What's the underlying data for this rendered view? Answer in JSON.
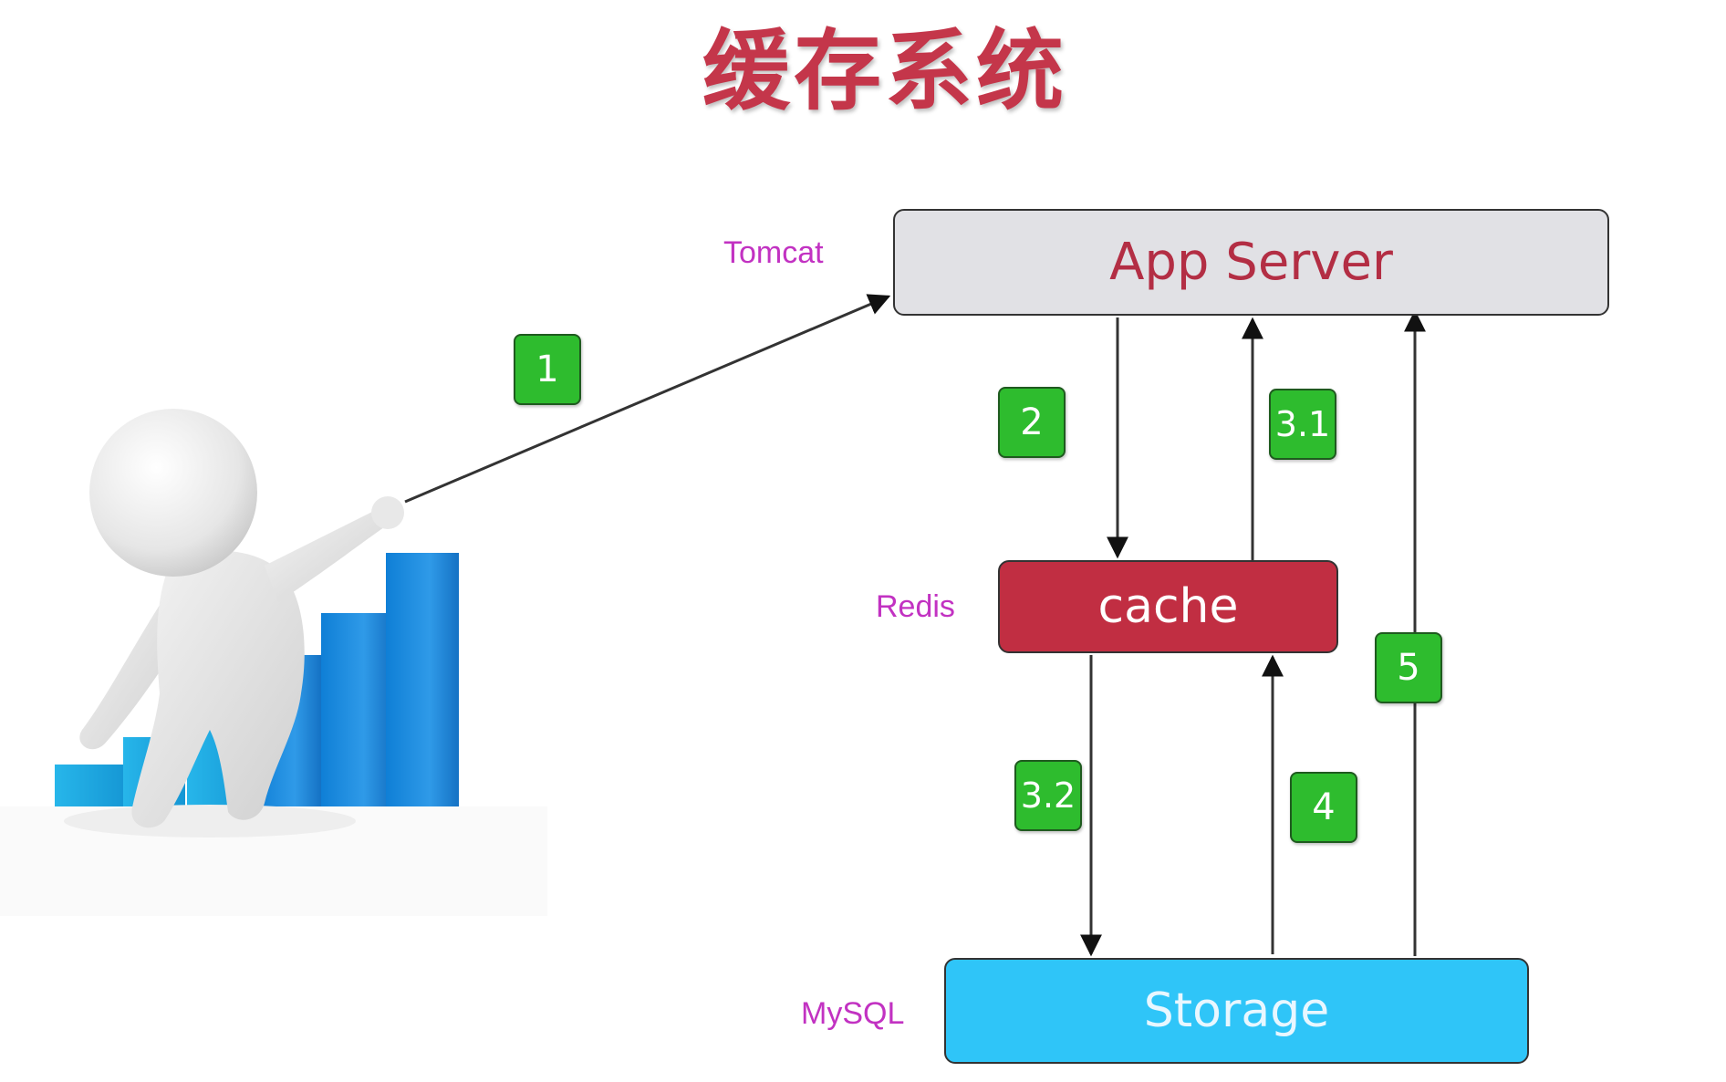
{
  "title": "缓存系统",
  "nodes": {
    "app_server": "App Server",
    "cache": "cache",
    "storage": "Storage"
  },
  "labels": {
    "tomcat": "Tomcat",
    "redis": "Redis",
    "mysql": "MySQL"
  },
  "steps": {
    "s1": "1",
    "s2": "2",
    "s3_1": "3.1",
    "s3_2": "3.2",
    "s4": "4",
    "s5": "5"
  },
  "colors": {
    "title": "#c4364a",
    "app_server_fill": "#e1e1e5",
    "cache_fill": "#c12e42",
    "storage_fill": "#2fc5f8",
    "step_fill": "#2ebc2e",
    "side_label": "#c232c2"
  }
}
